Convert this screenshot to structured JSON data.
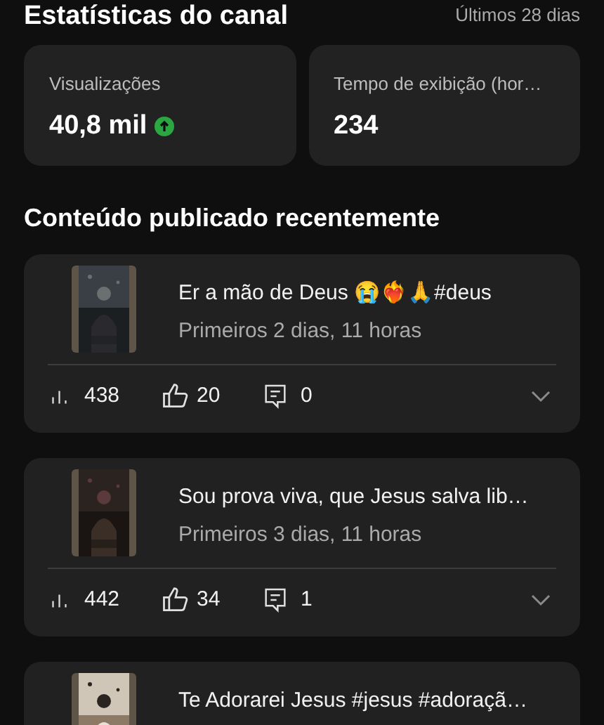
{
  "header": {
    "title": "Estatísticas do canal",
    "period": "Últimos 28 dias"
  },
  "stats": [
    {
      "label": "Visualizações",
      "value": "40,8 mil",
      "trending_up": true
    },
    {
      "label": "Tempo de exibição (hor…",
      "value": "234"
    }
  ],
  "section_title": "Conteúdo publicado recentemente",
  "videos": [
    {
      "title": "Er a mão de Deus 😭❤️‍🔥🙏#deus",
      "meta": "Primeiros 2 dias, 11 horas",
      "views": "438",
      "likes": "20",
      "comments": "0"
    },
    {
      "title": "Sou prova viva,  que Jesus salva lib…",
      "meta": "Primeiros 3 dias, 11 horas",
      "views": "442",
      "likes": "34",
      "comments": "1"
    },
    {
      "title": "Te Adorarei Jesus #jesus #adoraçã…"
    }
  ]
}
